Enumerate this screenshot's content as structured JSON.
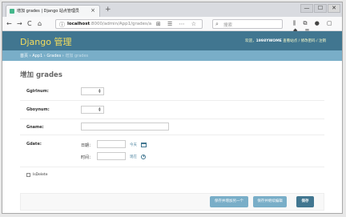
{
  "browser": {
    "tab_title": "增加 grades | Django 站点管理员",
    "tab_close": "×",
    "new_tab": "+",
    "window_controls": [
      "—",
      "☐",
      "✕"
    ],
    "nav": {
      "back": "←",
      "forward": "→",
      "reload": "C",
      "home": "⌂"
    },
    "url_host": "localhost",
    "url_path": ":8000/admin/App1/grades/a",
    "url_icons": "⊞ ☰ ⋯ ☆",
    "search_placeholder": "搜索",
    "toolbar_icons": [
      "⫼",
      "⧉",
      "●",
      "▢",
      "◆",
      "≡"
    ]
  },
  "admin": {
    "site_brand": "Django 管理",
    "user_tools": {
      "welcome": "欢迎，",
      "username": "1998YWOME",
      "links": "查看站点 / 修改密码 / 注销"
    },
    "breadcrumbs": {
      "home": "首页",
      "app": "App1",
      "model": "Grades",
      "current": "增加 grades",
      "sep": " › "
    },
    "page_title": "增加 grades"
  },
  "form": {
    "fields": [
      {
        "label": "Ggirlnum:",
        "value": ""
      },
      {
        "label": "Gboynum:",
        "value": ""
      },
      {
        "label": "Gname:",
        "value": ""
      }
    ],
    "gdate": {
      "label": "Gdate:",
      "date_label": "日期：",
      "date_value": "",
      "today_link": "今天",
      "time_label": "时间：",
      "time_value": "",
      "now_link": "现在"
    },
    "is_delete": {
      "label": "IsDelete",
      "checked": false
    }
  },
  "submit": {
    "save_add_another": "保存并增加另一个",
    "save_continue": "保存并继续编辑",
    "save": "保存"
  },
  "colors": {
    "header": "#417690",
    "breadcrumbs": "#79aec8",
    "brand": "#f5dd5d",
    "button": "#79aec8",
    "button_default": "#417690"
  }
}
